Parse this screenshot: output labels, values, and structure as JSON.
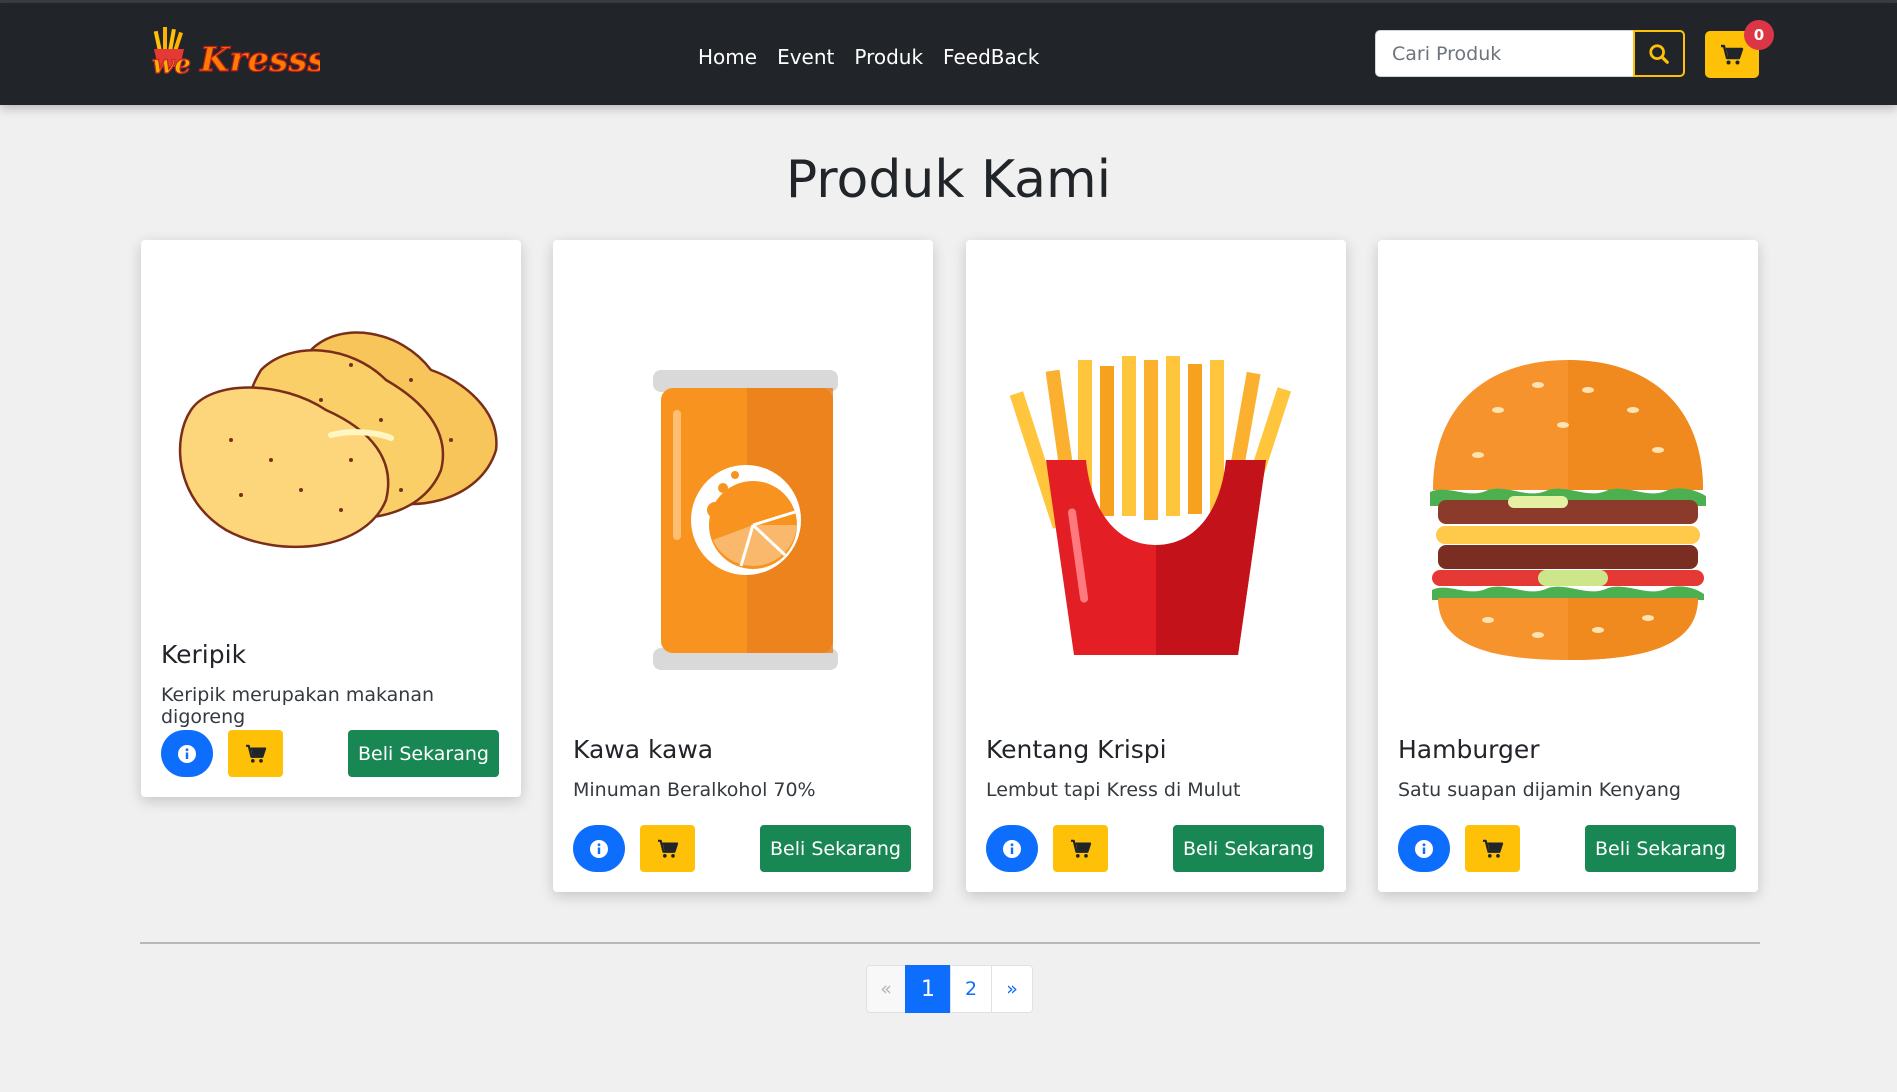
{
  "navbar": {
    "brand_logo_text": "weKresss",
    "links": [
      "Home",
      "Event",
      "Produk",
      "FeedBack"
    ],
    "search": {
      "placeholder": "Cari Produk",
      "value": ""
    },
    "search_icon": "search-icon",
    "cart_icon": "cart-icon",
    "cart_count": "0"
  },
  "main": {
    "title": "Produk Kami",
    "products": [
      {
        "name": "Keripik",
        "description": "Keripik merupakan makanan digoreng",
        "buy_label": "Beli Sekarang",
        "image": "chips-image"
      },
      {
        "name": "Kawa kawa",
        "description": "Minuman Beralkohol 70%",
        "buy_label": "Beli Sekarang",
        "image": "orange-can-image"
      },
      {
        "name": "Kentang Krispi",
        "description": "Lembut tapi Kress di Mulut",
        "buy_label": "Beli Sekarang",
        "image": "french-fries-image"
      },
      {
        "name": "Hamburger",
        "description": "Satu suapan dijamin Kenyang",
        "buy_label": "Beli Sekarang",
        "image": "hamburger-image"
      }
    ]
  },
  "pagination": {
    "prev": "«",
    "pages": [
      "1",
      "2"
    ],
    "active_page": "1",
    "next": "»"
  },
  "colors": {
    "navbar_bg": "#212529",
    "accent_yellow": "#ffc107",
    "primary_blue": "#0d6efd",
    "success_green": "#198754",
    "badge_red": "#dc3545",
    "page_bg": "#f0f0f0"
  }
}
